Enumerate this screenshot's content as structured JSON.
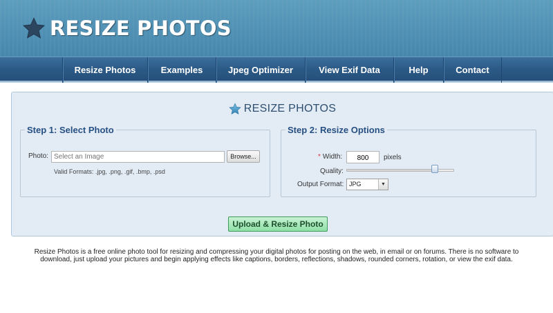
{
  "header": {
    "logo_text": "RESIZE PHOTOS",
    "logo_icon": "star-icon"
  },
  "nav": {
    "items": [
      {
        "label": "Resize Photos"
      },
      {
        "label": "Examples"
      },
      {
        "label": "Jpeg Optimizer"
      },
      {
        "label": "View Exif Data"
      },
      {
        "label": "Help"
      },
      {
        "label": "Contact"
      }
    ]
  },
  "panel": {
    "title": "RESIZE PHOTOS",
    "title_icon": "star-icon",
    "step1": {
      "legend": "Step 1: Select Photo",
      "photo_label": "Photo:",
      "photo_placeholder": "Select an Image",
      "browse_label": "Browse...",
      "formats_text": "Valid Formats: .jpg, .png, .gif, .bmp, .psd"
    },
    "step2": {
      "legend": "Step 2: Resize Options",
      "required_marker": "*",
      "width_label": "Width:",
      "width_value": "800",
      "width_unit": "pixels",
      "quality_label": "Quality:",
      "quality_level": 0.82,
      "format_label": "Output Format:",
      "format_value": "JPG"
    },
    "upload_label": "Upload & Resize Photo"
  },
  "description": "Resize Photos is a free online photo tool for resizing and compressing your digital photos for posting on the web, in email or on forums. There is no software to download, just upload your pictures and begin applying effects like captions, borders, reflections, shadows, rounded corners, rotation, or view the exif data.",
  "colors": {
    "header_blue": "#4b8bb0",
    "nav_blue": "#2c5a87",
    "panel_bg": "#e3ebf5",
    "legend_blue": "#264f82",
    "upload_green": "#8fe0a7"
  }
}
